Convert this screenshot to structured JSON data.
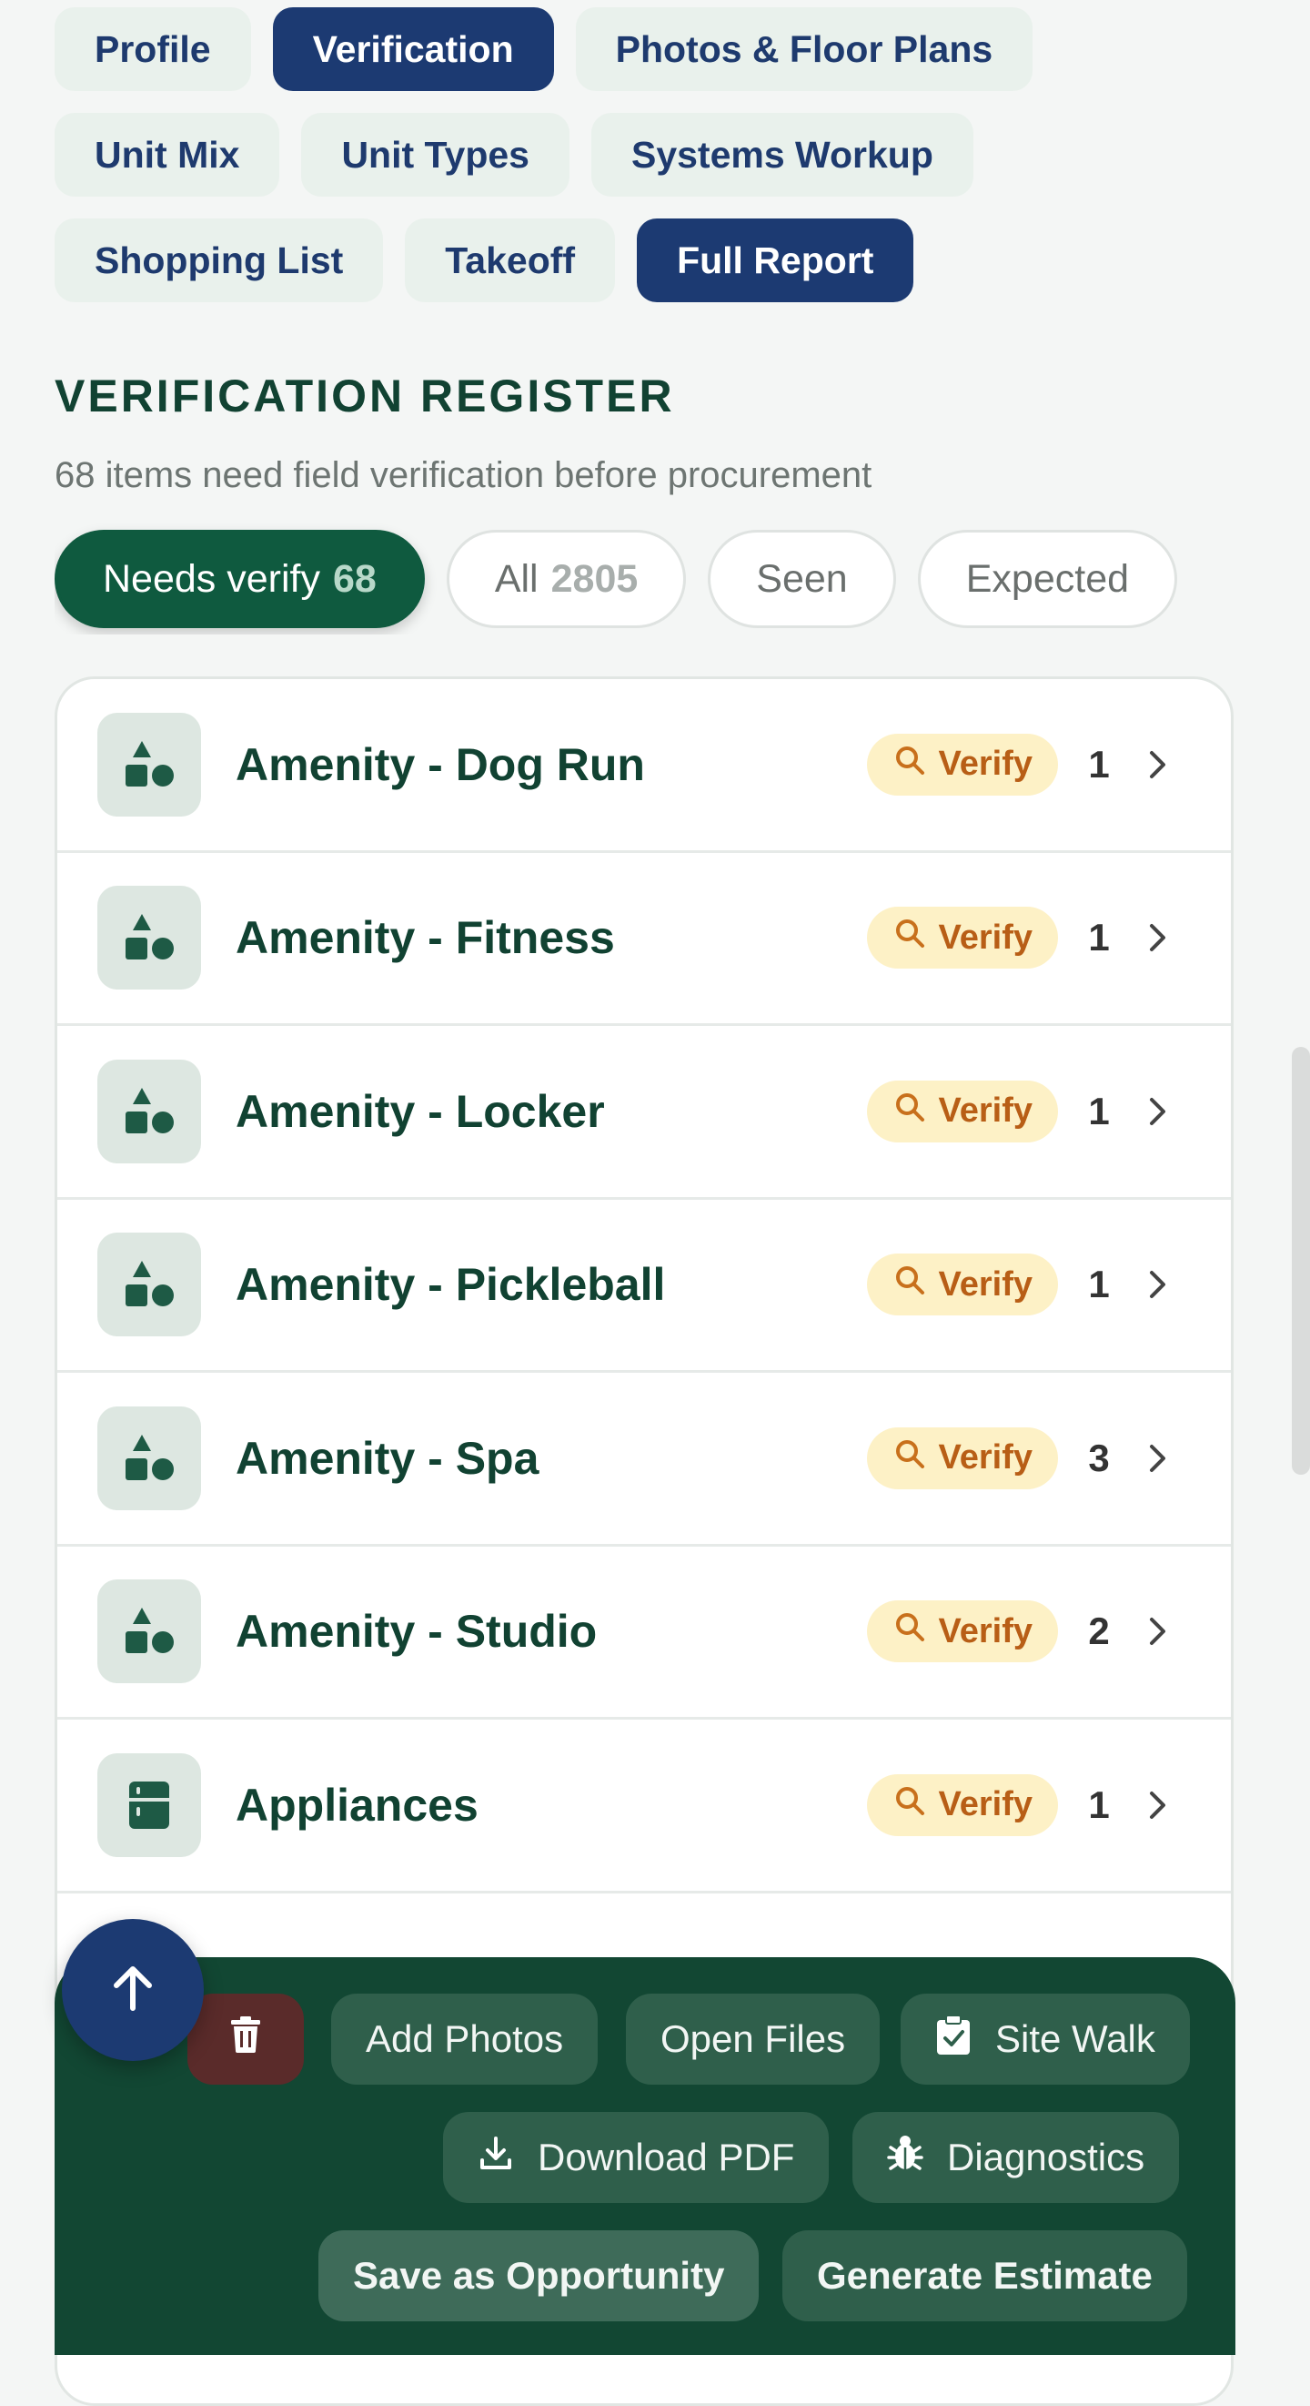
{
  "tabs": [
    [
      {
        "label": "Profile",
        "active": false
      },
      {
        "label": "Verification",
        "active": true
      },
      {
        "label": "Photos & Floor Plans",
        "active": false
      }
    ],
    [
      {
        "label": "Unit Mix",
        "active": false
      },
      {
        "label": "Unit Types",
        "active": false
      },
      {
        "label": "Systems Workup",
        "active": false
      }
    ],
    [
      {
        "label": "Shopping List",
        "active": false
      },
      {
        "label": "Takeoff",
        "active": false
      },
      {
        "label": "Full Report",
        "active": true
      }
    ]
  ],
  "section": {
    "title": "VERIFICATION REGISTER",
    "subtitle": "68 items need field verification before procurement"
  },
  "filters": [
    {
      "label": "Needs verify",
      "count": "68",
      "active": true
    },
    {
      "label": "All",
      "count": "2805",
      "active": false
    },
    {
      "label": "Seen",
      "count": "",
      "active": false
    },
    {
      "label": "Expected",
      "count": "",
      "active": false
    }
  ],
  "items": [
    {
      "label": "Amenity - Dog Run",
      "badge": "Verify",
      "count": "1",
      "icon": "shapes-icon"
    },
    {
      "label": "Amenity - Fitness",
      "badge": "Verify",
      "count": "1",
      "icon": "shapes-icon"
    },
    {
      "label": "Amenity - Locker",
      "badge": "Verify",
      "count": "1",
      "icon": "shapes-icon"
    },
    {
      "label": "Amenity - Pickleball",
      "badge": "Verify",
      "count": "1",
      "icon": "shapes-icon"
    },
    {
      "label": "Amenity - Spa",
      "badge": "Verify",
      "count": "3",
      "icon": "shapes-icon"
    },
    {
      "label": "Amenity - Studio",
      "badge": "Verify",
      "count": "2",
      "icon": "shapes-icon"
    },
    {
      "label": "Appliances",
      "badge": "Verify",
      "count": "1",
      "icon": "appliance-icon"
    }
  ],
  "actions": {
    "add_photos": "Add Photos",
    "open_files": "Open Files",
    "site_walk": "Site Walk",
    "download_pdf": "Download PDF",
    "diagnostics": "Diagnostics",
    "save_opportunity": "Save as Opportunity",
    "generate_estimate": "Generate Estimate"
  },
  "colors": {
    "primary_navy": "#1c3a72",
    "brand_green": "#0f5a3f",
    "panel_green": "#124733",
    "verify_badge_bg": "#fdf1c6",
    "verify_badge_text": "#b85e16"
  }
}
